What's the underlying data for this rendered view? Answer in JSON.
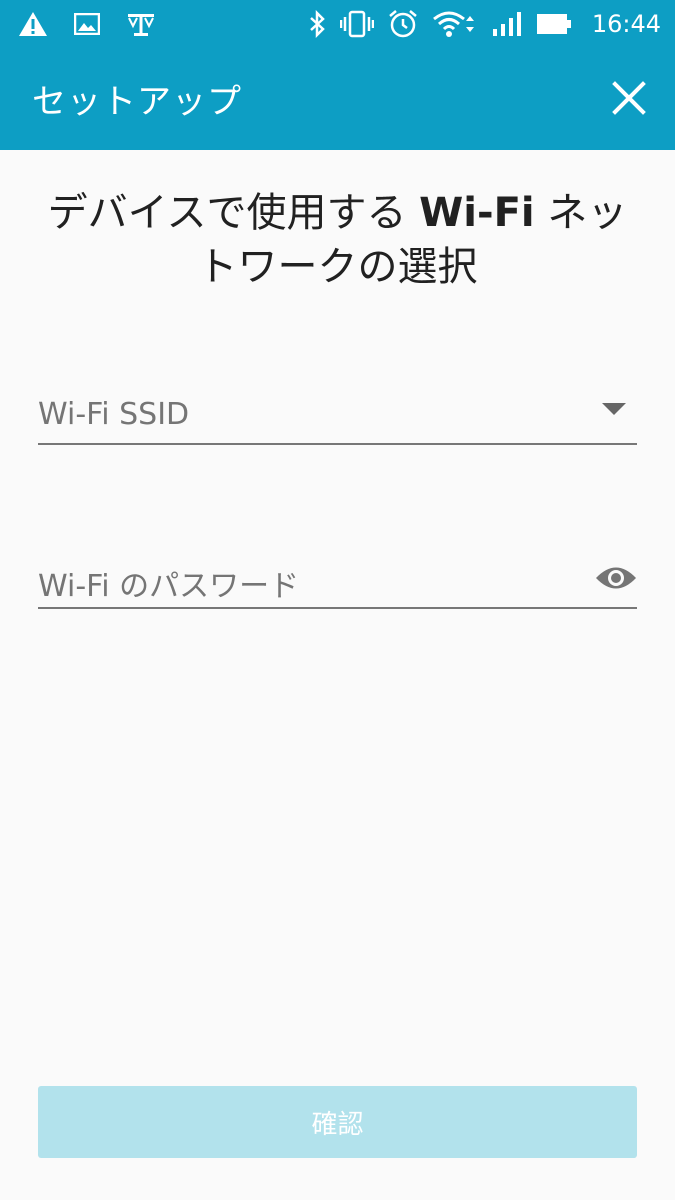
{
  "status_bar": {
    "time": "16:44",
    "left_icons": [
      "warning-icon",
      "image-icon",
      "scale-icon"
    ],
    "right_icons": [
      "bluetooth-icon",
      "vibrate-icon",
      "alarm-icon",
      "wifi-icon",
      "signal-icon",
      "battery-icon"
    ]
  },
  "app_bar": {
    "title": "セットアップ",
    "close_icon": "close-icon"
  },
  "heading": {
    "part1": "デバイスで使用する ",
    "bold": "Wi-Fi",
    "part2": " ネットワークの選択"
  },
  "ssid_field": {
    "placeholder": "Wi-Fi SSID",
    "value": "",
    "icon": "dropdown-arrow-icon"
  },
  "password_field": {
    "placeholder": "Wi-Fi のパスワード",
    "value": "",
    "icon": "eye-icon"
  },
  "confirm_button": {
    "label": "確認",
    "enabled": false
  },
  "colors": {
    "primary": "#0d9ec4",
    "background": "#fafafa",
    "button_disabled": "#b2e2ec",
    "underline": "#777777",
    "placeholder": "#757575"
  }
}
